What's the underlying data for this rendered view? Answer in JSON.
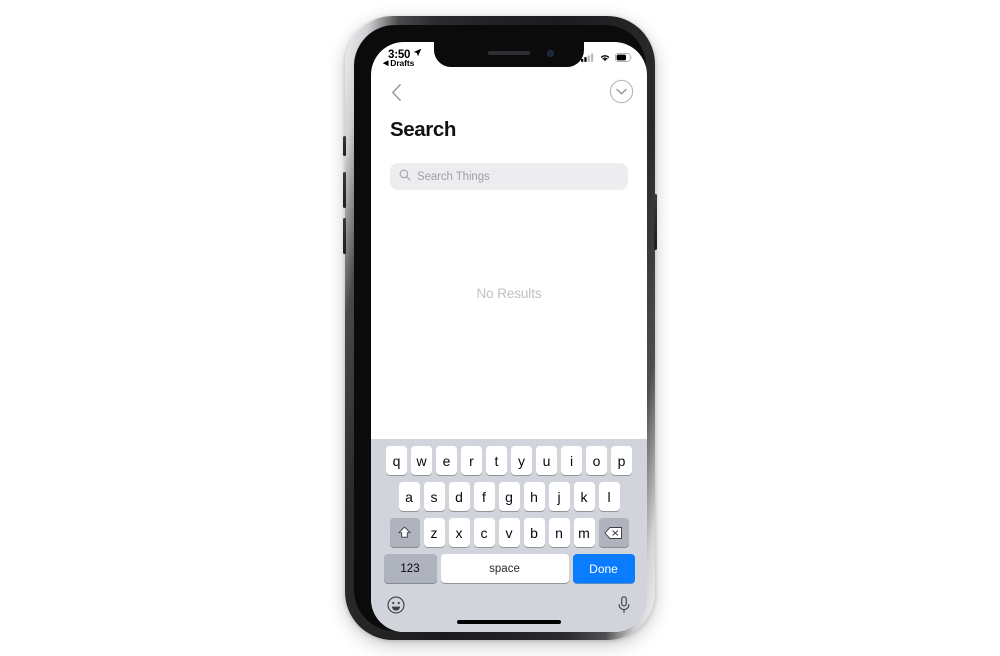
{
  "device": {
    "name": "iphone-x",
    "notch": {
      "speaker": "speaker-grille",
      "camera": "front-camera"
    }
  },
  "status_bar": {
    "time": "3:50",
    "location_icon": "location-arrow-icon",
    "return_app_label": "Drafts",
    "return_back_glyph": "◀",
    "signal_icon": "cellular-signal-icon",
    "signal_bars_filled": 2,
    "signal_bars_total": 4,
    "wifi_icon": "wifi-icon",
    "battery_icon": "battery-icon",
    "battery_level_percent": 65
  },
  "nav_bar": {
    "back_icon": "chevron-left-icon",
    "collapse_icon": "chevron-down-circle-icon"
  },
  "content": {
    "title": "Search",
    "search": {
      "icon": "search-icon",
      "placeholder": "Search Things",
      "value": ""
    },
    "empty_state": "No Results"
  },
  "keyboard": {
    "layout": "qwerty-lowercase",
    "row1": [
      "q",
      "w",
      "e",
      "r",
      "t",
      "y",
      "u",
      "i",
      "o",
      "p"
    ],
    "row2": [
      "a",
      "s",
      "d",
      "f",
      "g",
      "h",
      "j",
      "k",
      "l"
    ],
    "row3": [
      "z",
      "x",
      "c",
      "v",
      "b",
      "n",
      "m"
    ],
    "shift_icon": "shift-arrow-icon",
    "backspace_icon": "backspace-delete-icon",
    "numbers_label": "123",
    "space_label": "space",
    "done_label": "Done",
    "emoji_icon": "emoji-smiley-icon",
    "dictation_icon": "microphone-icon"
  },
  "colors": {
    "accent_blue": "#0a7cff",
    "keyboard_background": "#d1d5db",
    "key_white": "#ffffff",
    "key_gray": "#aeb3bd",
    "search_field_background": "#ededef",
    "placeholder_gray": "#a0a0a6",
    "empty_state_gray": "#c2c2c7",
    "title_black": "#111114"
  }
}
